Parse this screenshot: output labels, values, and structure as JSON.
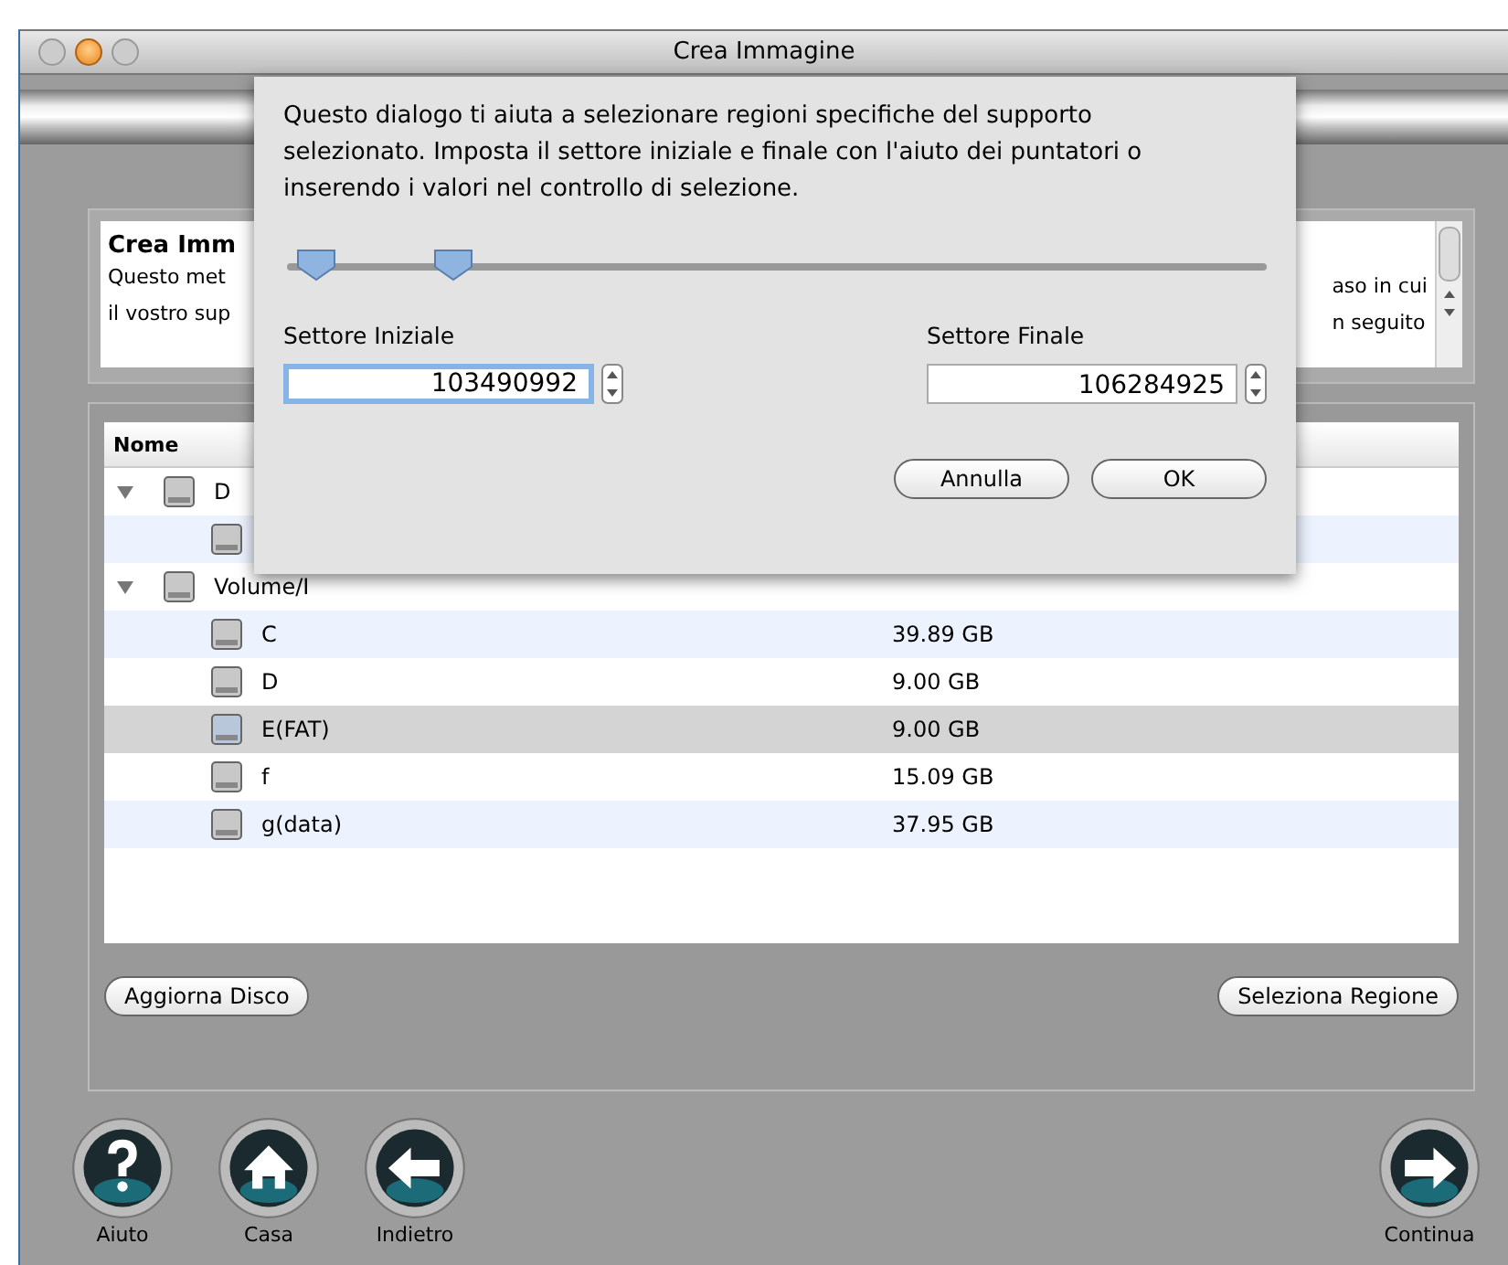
{
  "window": {
    "title": "Crea Immagine"
  },
  "info": {
    "title": "Crea Imm",
    "lines_left": [
      "Questo met",
      "il vostro sup"
    ],
    "lines_right": [
      "aso in cui",
      "n seguito"
    ]
  },
  "table": {
    "columns": [
      "Nome"
    ],
    "rows": [
      {
        "name": "D",
        "expanded": true,
        "selected": false,
        "children": [
          {
            "selected": false
          }
        ]
      },
      {
        "name": "Volume/I",
        "expanded": true,
        "selected": false,
        "children": [
          {
            "name": "C",
            "size": "39.89 GB",
            "selected": false
          },
          {
            "name": "D",
            "size": "9.00 GB",
            "selected": false
          },
          {
            "name": "E(FAT)",
            "size": "9.00 GB",
            "selected": true
          },
          {
            "name": "f",
            "size": "15.09 GB",
            "selected": false
          },
          {
            "name": "g(data)",
            "size": "37.95 GB",
            "selected": false
          }
        ]
      }
    ]
  },
  "buttons": [
    "Aggiorna Disco",
    "Seleziona Regione"
  ],
  "toolbar": [
    {
      "kind": "help",
      "label": "Aiuto"
    },
    {
      "kind": "home",
      "label": "Casa"
    },
    {
      "kind": "back",
      "label": "Indietro"
    },
    {
      "kind": "next",
      "label": "Continua"
    }
  ],
  "dialog": {
    "message": "Questo dialogo ti aiuta a selezionare regioni specifiche del supporto selezionato. Imposta il settore iniziale e finale con l'aiuto dei puntatori o inserendo i valori nel controllo di selezione.",
    "thumbs": [
      {
        "level": 0.02
      },
      {
        "level": 0.16
      }
    ],
    "fields": [
      {
        "label": "Settore Iniziale",
        "value": "103490992",
        "focused": true
      },
      {
        "label": "Settore Finale",
        "value": "106284925",
        "focused": false
      }
    ],
    "buttons": [
      "Annulla",
      "OK"
    ]
  }
}
